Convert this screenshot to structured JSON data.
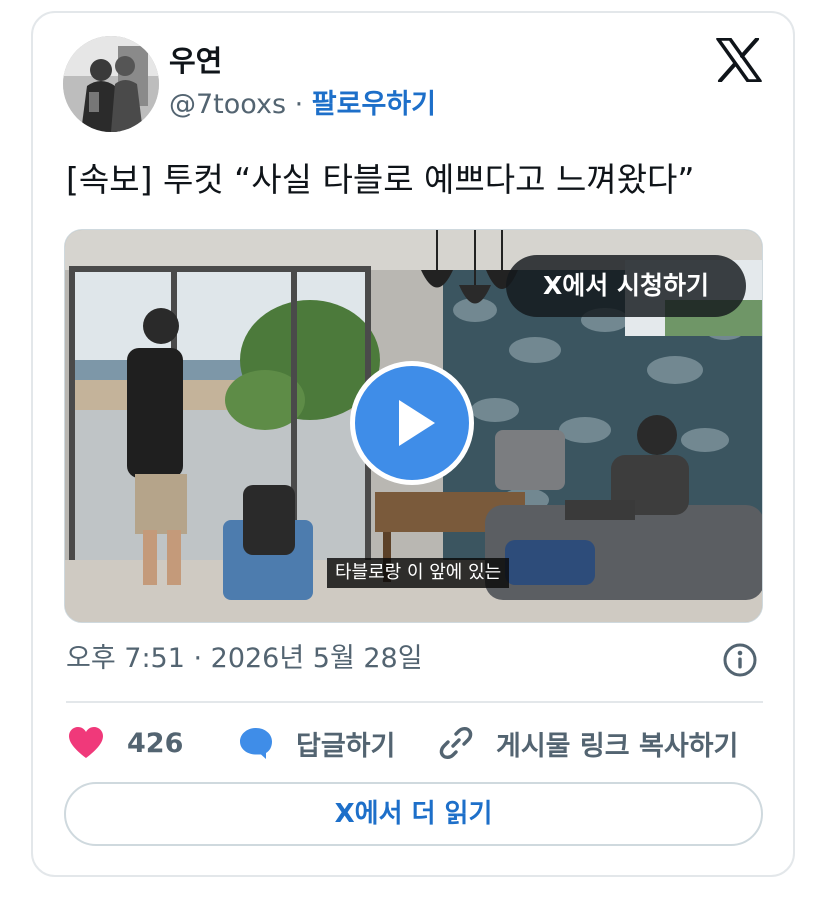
{
  "author": {
    "display_name": "우연",
    "handle": "@7tooxs",
    "separator": " · ",
    "follow_label": "팔로우하기"
  },
  "tweet": {
    "text": "[속보] 투컷 “사실 타블로 예쁘다고 느껴왔다”",
    "timestamp": "오후 7:51 · 2026년 5월 28일"
  },
  "media": {
    "watch_label": "X에서 시청하기",
    "subtitle": "타블로랑 이 앞에 있는"
  },
  "actions": {
    "like_count": "426",
    "reply_label": "답글하기",
    "copy_link_label": "게시물 링크 복사하기"
  },
  "footer": {
    "read_more_label": "X에서 더 읽기"
  },
  "colors": {
    "accent": "#1d6fc9",
    "like": "#f0397a",
    "reply": "#3f8de8",
    "play": "#3f8de8",
    "muted": "#536471",
    "border": "#e3e7ea"
  },
  "icons": [
    "x-logo-icon",
    "play-icon",
    "heart-icon",
    "speech-bubble-icon",
    "link-icon",
    "info-icon"
  ]
}
